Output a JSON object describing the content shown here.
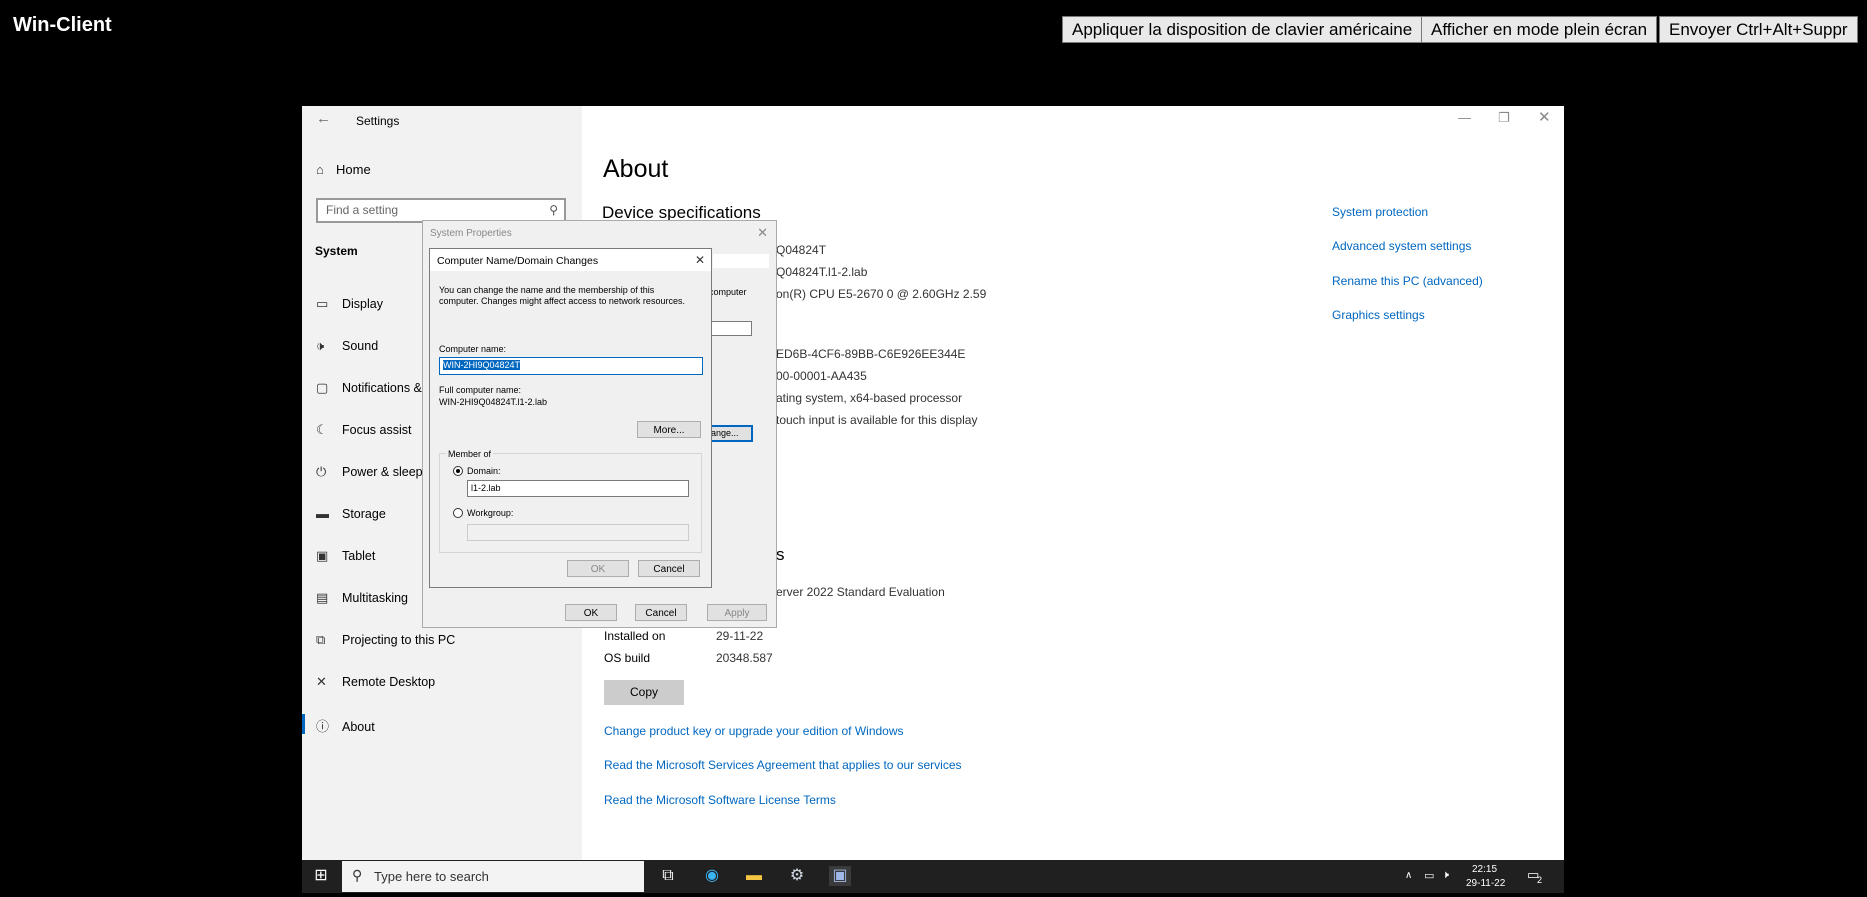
{
  "top_bar": {
    "title": "Win-Client",
    "buttons": [
      "Appliquer la disposition de clavier américaine",
      "Afficher en mode plein écran",
      "Envoyer Ctrl+Alt+Suppr"
    ]
  },
  "settings": {
    "window_title": "Settings",
    "home": "Home",
    "search_placeholder": "Find a setting",
    "section": "System",
    "nav": [
      "Display",
      "Sound",
      "Notifications &",
      "Focus assist",
      "Power & sleep",
      "Storage",
      "Tablet",
      "Multitasking",
      "Projecting to this PC",
      "Remote Desktop",
      "About"
    ],
    "active_nav": "About",
    "page_title": "About",
    "device_specs_heading": "Device specifications",
    "specs_partial": [
      "Q04824T",
      "Q04824T.l1-2.lab",
      "on(R) CPU E5-2670 0 @ 2.60GHz   2.59",
      "ED6B-4CF6-89BB-C6E926EE344E",
      "00-00001-AA435",
      "ating system, x64-based processor",
      "touch input is available for this display"
    ],
    "windows_specs_heading_partial": "s",
    "edition_partial": "erver 2022 Standard Evaluation",
    "installed_on_label": "Installed on",
    "installed_on_value": "29-11-22",
    "os_build_label": "OS build",
    "os_build_value": "20348.587",
    "copy_button": "Copy",
    "links": [
      "Change product key or upgrade your edition of Windows",
      "Read the Microsoft Services Agreement that applies to our services",
      "Read the Microsoft Software License Terms"
    ],
    "related_links": [
      "System protection",
      "Advanced system settings",
      "Rename this PC (advanced)",
      "Graphics settings"
    ]
  },
  "system_properties": {
    "title": "System Properties",
    "partial_computer": "computer",
    "partial_change": "ange...",
    "ok": "OK",
    "cancel": "Cancel",
    "apply": "Apply"
  },
  "computer_name_dialog": {
    "title": "Computer Name/Domain Changes",
    "description_line1": "You can change the name and the membership of this",
    "description_line2": "computer. Changes might affect access to network resources.",
    "computer_name_label": "Computer name:",
    "computer_name_value": "WIN-2HI9Q04824T",
    "full_name_label": "Full computer name:",
    "full_name_value": "WIN-2HI9Q04824T.l1-2.lab",
    "more_button": "More...",
    "member_of_label": "Member of",
    "domain_label": "Domain:",
    "domain_value": "l1-2.lab",
    "workgroup_label": "Workgroup:",
    "workgroup_value": "",
    "ok": "OK",
    "cancel": "Cancel"
  },
  "taskbar": {
    "search_placeholder": "Type here to search",
    "time": "22:15",
    "date": "29-11-22",
    "notification_count": "2"
  }
}
